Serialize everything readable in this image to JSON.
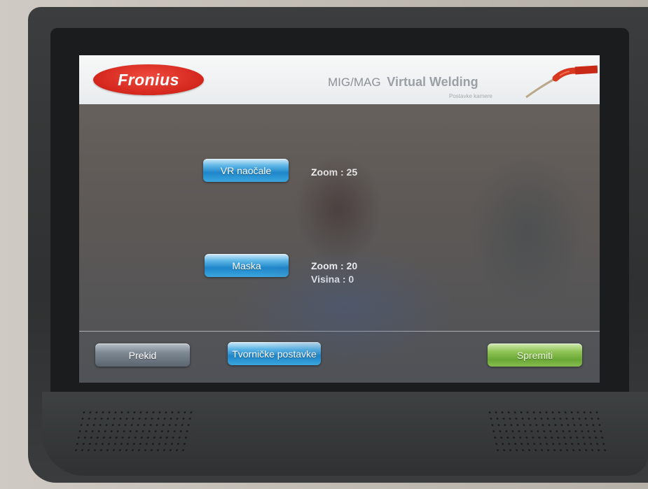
{
  "header": {
    "logo_text": "Fronius",
    "title_prefix": "MIG/MAG",
    "title_main": "Virtual Welding",
    "subtitle": "Postavke kamere"
  },
  "settings": {
    "vr_button_label": "VR naočale",
    "vr_zoom": "Zoom : 25",
    "mask_button_label": "Maska",
    "mask_zoom": "Zoom : 20",
    "mask_height": "Visina : 0"
  },
  "footer": {
    "cancel_label": "Prekid",
    "defaults_label": "Tvorničke postavke",
    "save_label": "Spremiti"
  },
  "colors": {
    "logo_red": "#d4261d",
    "button_blue": "#1f86c9",
    "button_gray": "#6b7580",
    "button_green": "#6aa836",
    "header_bg": "#f2f4f5"
  }
}
